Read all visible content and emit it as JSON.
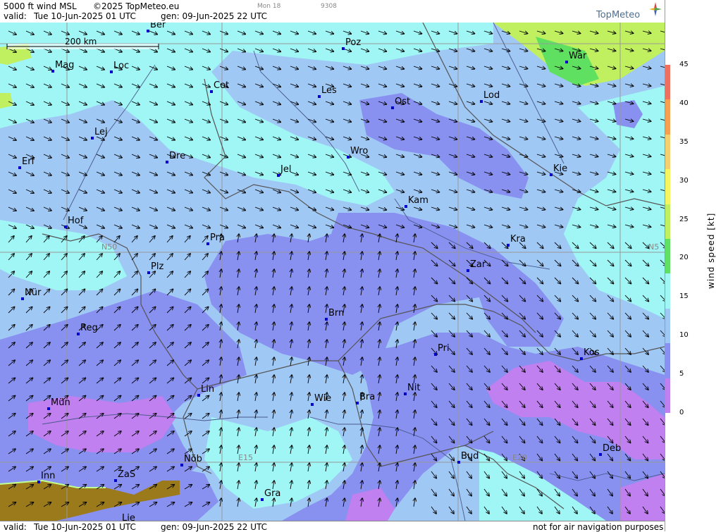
{
  "header": {
    "product": "5000 ft wind MSL",
    "copyright": "©2025 TopMeteo.eu",
    "valid_label": "valid:",
    "valid_value": "Tue  10-Jun-2025  01 UTC",
    "gen_value": "gen: 09-Jun-2025 22 UTC",
    "small_1": "Mon 18",
    "small_2": "9308",
    "logo": "TopMeteo"
  },
  "footer": {
    "valid_label": "valid:",
    "valid_value": "Tue  10-Jun-2025  01 UTC",
    "gen_value": "gen: 09-Jun-2025 22 UTC",
    "disclaimer": "not for air navigation purposes"
  },
  "scale_bar": {
    "label": "200 km"
  },
  "grid_labels": {
    "n50_left": "N50",
    "n50_right": "N5",
    "e15": "E15",
    "e20": "E20"
  },
  "legend": {
    "title": "wind speed [kt]",
    "ticks": [
      "45",
      "40",
      "35",
      "30",
      "25",
      "20",
      "15",
      "10",
      "5",
      "0"
    ],
    "colors": [
      "#f07060",
      "#f5a050",
      "#f5d070",
      "#f5f560",
      "#c0f060",
      "#60e060",
      "#a0f5f5",
      "#a0c8f5",
      "#8890f0",
      "#c080f0"
    ]
  },
  "cities": [
    {
      "name": "Ber"
    },
    {
      "name": "Poz"
    },
    {
      "name": "War"
    },
    {
      "name": "Mag"
    },
    {
      "name": "Loc"
    },
    {
      "name": "Cot"
    },
    {
      "name": "Les"
    },
    {
      "name": "Ost"
    },
    {
      "name": "Lod"
    },
    {
      "name": "Lej"
    },
    {
      "name": "Erf"
    },
    {
      "name": "Dre"
    },
    {
      "name": "Wro"
    },
    {
      "name": "Jel"
    },
    {
      "name": "Kie"
    },
    {
      "name": "Kam"
    },
    {
      "name": "Hof"
    },
    {
      "name": "Pra"
    },
    {
      "name": "Kra"
    },
    {
      "name": "Zar"
    },
    {
      "name": "Plz"
    },
    {
      "name": "Nür"
    },
    {
      "name": "Brn"
    },
    {
      "name": "Reg"
    },
    {
      "name": "Pri"
    },
    {
      "name": "Kos"
    },
    {
      "name": "Lin"
    },
    {
      "name": "Nit"
    },
    {
      "name": "Wie"
    },
    {
      "name": "Bra"
    },
    {
      "name": "Mün"
    },
    {
      "name": "Deb"
    },
    {
      "name": "Nöb"
    },
    {
      "name": "Bud"
    },
    {
      "name": "Inn"
    },
    {
      "name": "ZaS"
    },
    {
      "name": "Gra"
    },
    {
      "name": "Lie"
    }
  ]
}
